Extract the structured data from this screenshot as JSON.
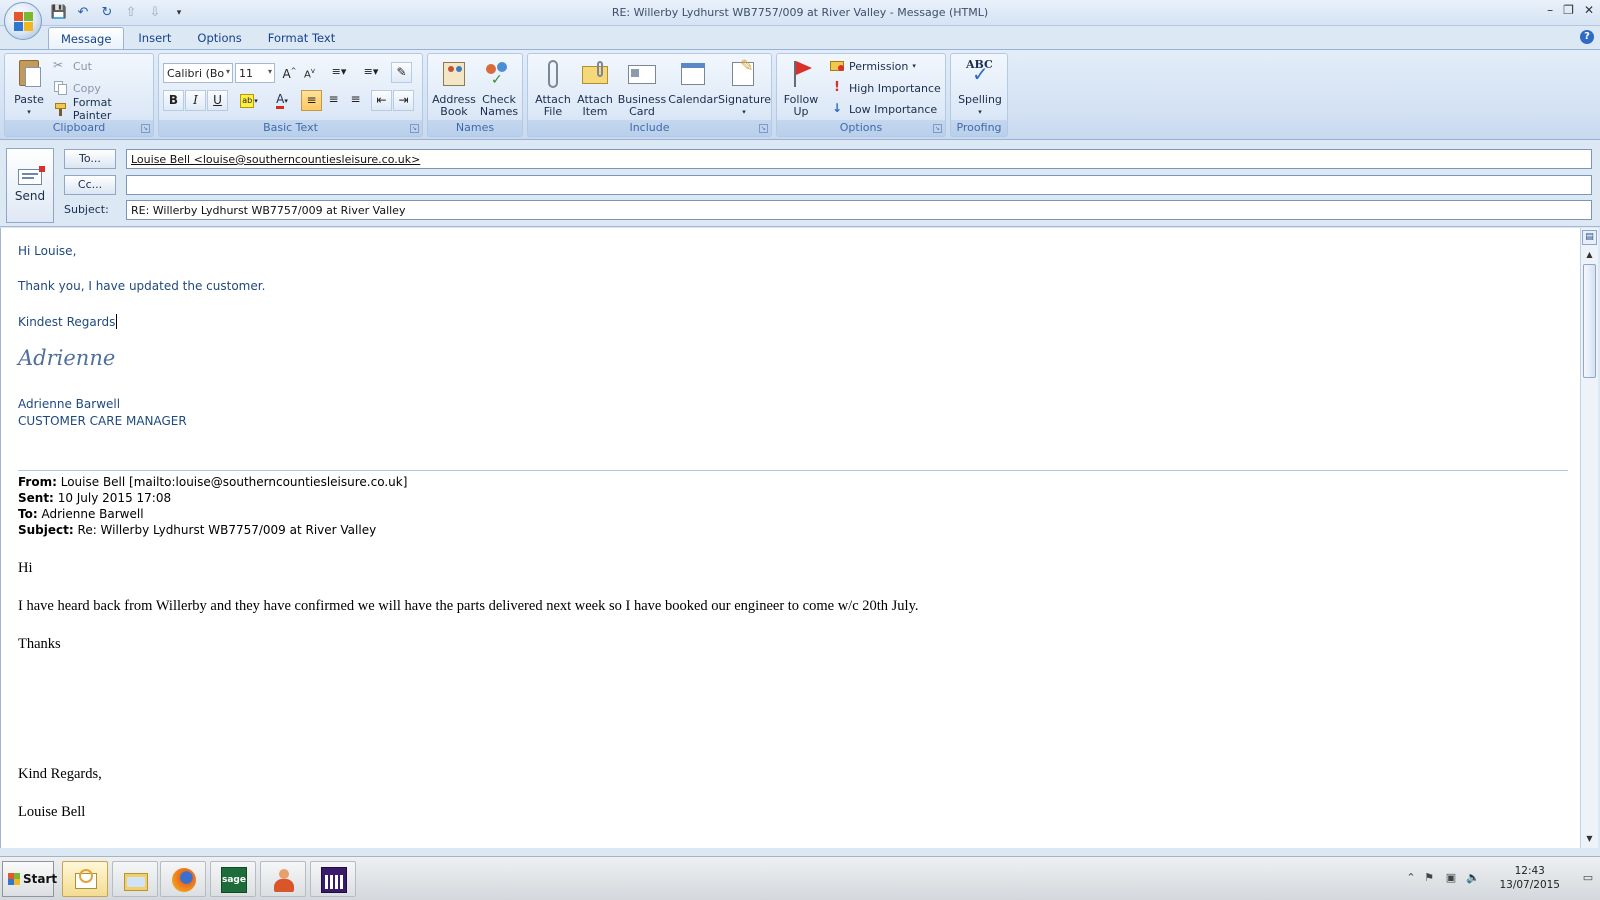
{
  "window": {
    "title": "RE: Willerby Lydhurst WB7757/009 at River Valley - Message (HTML)",
    "controls": [
      "–",
      "❐",
      "✕"
    ]
  },
  "quick_access": [
    "save-icon",
    "undo-icon",
    "redo-icon",
    "up-icon",
    "down-icon",
    "customize-icon"
  ],
  "tabs": [
    {
      "label": "Message",
      "active": true
    },
    {
      "label": "Insert"
    },
    {
      "label": "Options"
    },
    {
      "label": "Format Text"
    }
  ],
  "ribbon": {
    "clipboard": {
      "label": "Clipboard",
      "paste": "Paste",
      "cut": "Cut",
      "copy": "Copy",
      "format_painter": "Format Painter"
    },
    "basic_text": {
      "label": "Basic Text",
      "font": "Calibri (Bo",
      "size": "11",
      "bold": "B",
      "italic": "I",
      "underline": "U",
      "font_color": "A"
    },
    "names": {
      "label": "Names",
      "address_book": [
        "Address",
        "Book"
      ],
      "check_names": [
        "Check",
        "Names"
      ]
    },
    "include": {
      "label": "Include",
      "attach_file": [
        "Attach",
        "File"
      ],
      "attach_item": [
        "Attach",
        "Item"
      ],
      "business_card": [
        "Business",
        "Card"
      ],
      "calendar": "Calendar",
      "signature": "Signature"
    },
    "options": {
      "label": "Options",
      "follow_up": [
        "Follow",
        "Up"
      ],
      "permission": "Permission",
      "high_importance": "High Importance",
      "low_importance": "Low Importance"
    },
    "proofing": {
      "label": "Proofing",
      "abc": "ABC",
      "spelling": "Spelling"
    }
  },
  "header": {
    "send_label": "Send",
    "to_button": "To...",
    "cc_button": "Cc...",
    "subject_label": "Subject:",
    "to_value": "Louise Bell <louise@southerncountiesleisure.co.uk>",
    "cc_value": "",
    "subject_value": "RE: Willerby Lydhurst WB7757/009 at River Valley"
  },
  "body": {
    "greeting": "Hi Louise,",
    "line1": "Thank you, I have updated the customer.",
    "closing": "Kindest Regards",
    "signature_script": "Adrienne",
    "sender_name": "Adrienne Barwell",
    "sender_title": "CUSTOMER CARE MANAGER",
    "quoted": {
      "from_label": "From:",
      "from_value": "Louise Bell [mailto:louise@southerncountiesleisure.co.uk]",
      "sent_label": "Sent:",
      "sent_value": "10 July 2015 17:08",
      "to_label": "To:",
      "to_value": "Adrienne Barwell",
      "subject_label": "Subject:",
      "subject_value": "Re: Willerby Lydhurst WB7757/009 at River Valley",
      "hi": "Hi",
      "message": "I have heard back from Willerby and they have confirmed we will have the parts delivered next week so I have booked our engineer to come w/c 20th July.",
      "thanks": "Thanks",
      "kind_regards": "Kind Regards,",
      "name": "Louise Bell"
    }
  },
  "taskbar": {
    "start_label": "Start",
    "apps": [
      "outlook-icon",
      "explorer-icon",
      "firefox-icon",
      "sage-icon",
      "user-icon",
      "calculator-icon"
    ],
    "clock_time": "12:43",
    "clock_date": "13/07/2015"
  }
}
